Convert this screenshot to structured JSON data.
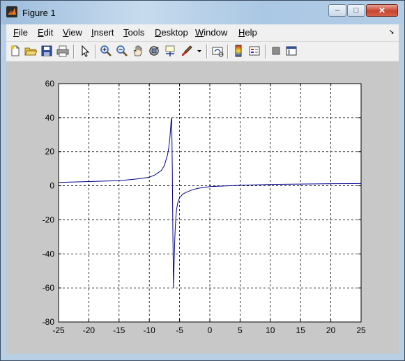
{
  "window": {
    "title": "Figure 1",
    "buttons": {
      "minimize": "–",
      "maximize": "□",
      "close": "✕"
    }
  },
  "menubar": {
    "items": [
      "File",
      "Edit",
      "View",
      "Insert",
      "Tools",
      "Desktop",
      "Window",
      "Help"
    ]
  },
  "toolbar": {
    "icons": [
      "new-figure-icon",
      "open-file-icon",
      "save-icon",
      "print-icon",
      "pointer-icon",
      "zoom-in-icon",
      "zoom-out-icon",
      "pan-hand-icon",
      "rotate-3d-icon",
      "data-cursor-icon",
      "brush-icon",
      "link-plot-icon",
      "colorbar-icon",
      "legend-icon",
      "hide-plot-tools-icon",
      "show-plot-tools-icon"
    ]
  },
  "colors": {
    "line": "#00008b",
    "figure_bg": "#c8c8c8",
    "axes_bg": "#ffffff"
  },
  "chart_data": {
    "type": "line",
    "title": "",
    "xlabel": "",
    "ylabel": "",
    "xlim": [
      -25,
      25
    ],
    "ylim": [
      -80,
      60
    ],
    "xticks": [
      -25,
      -20,
      -15,
      -10,
      -5,
      0,
      5,
      10,
      15,
      20,
      25
    ],
    "yticks": [
      -80,
      -60,
      -40,
      -20,
      0,
      20,
      40,
      60
    ],
    "xtick_labels": [
      "-25",
      "-20",
      "-15",
      "-10",
      "-5",
      "0",
      "5",
      "10",
      "15",
      "20",
      "25"
    ],
    "ytick_labels": [
      "-80",
      "-60",
      "-40",
      "-20",
      "0",
      "20",
      "40",
      "60"
    ],
    "grid": true,
    "grid_style": "dashed",
    "series": [
      {
        "x": [
          -25,
          -20,
          -15,
          -12,
          -10,
          -9,
          -8,
          -7.5,
          -7,
          -6.8,
          -6.6,
          -6.5,
          -6.4,
          -6.3,
          -6.2,
          -6.1,
          -6.0,
          -5.9,
          -5.8,
          -5.7,
          -5.6,
          -5.5,
          -5.3,
          -5.0,
          -4.5,
          -4,
          -3,
          -2,
          0,
          5,
          10,
          15,
          20,
          25
        ],
        "y": [
          2,
          2.5,
          3,
          4,
          5,
          6.5,
          9,
          12,
          18,
          22,
          28,
          33,
          38,
          40,
          10,
          -30,
          -60,
          -45,
          -32,
          -24,
          -18,
          -14,
          -10,
          -7,
          -5,
          -4,
          -2.5,
          -1.5,
          -0.5,
          0.3,
          0.8,
          1.0,
          1.2,
          1.3
        ]
      }
    ]
  }
}
